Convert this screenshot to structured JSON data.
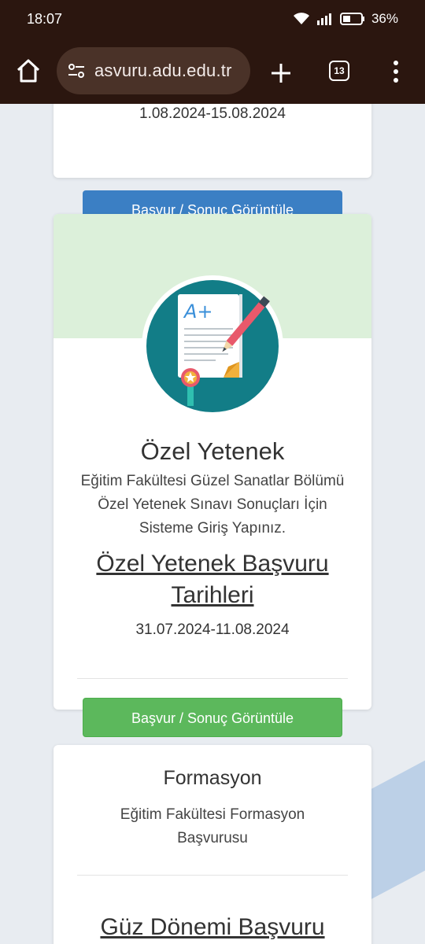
{
  "status_bar": {
    "time": "18:07",
    "battery": "36%"
  },
  "browser": {
    "url": "asvuru.adu.edu.tr",
    "tab_count": "13"
  },
  "prev_card": {
    "dates": "1.08.2024-15.08.2024",
    "button_label": "Başvur / Sonuç Görüntüle"
  },
  "ozel_card": {
    "title": "Özel Yetenek",
    "description": "Eğitim Fakültesi Güzel Sanatlar Bölümü Özel Yetenek Sınavı Sonuçları İçin Sisteme Giriş Yapınız.",
    "link": "Özel Yetenek Başvuru Tarihleri",
    "dates": "31.07.2024-11.08.2024",
    "button_label": "Başvur / Sonuç Görüntüle",
    "icon": "exam-paper-icon",
    "icon_text": "A+"
  },
  "formasyon_card": {
    "title": "Formasyon",
    "description": "Eğitim Fakültesi Formasyon Başvurusu",
    "link": "Güz Dönemi Başvuru"
  },
  "colors": {
    "browser_chrome": "#2b160f",
    "button_blue": "#3b7fc4",
    "button_green": "#5cb85c",
    "card_band": "#dcf0da",
    "icon_teal": "#127d87"
  }
}
